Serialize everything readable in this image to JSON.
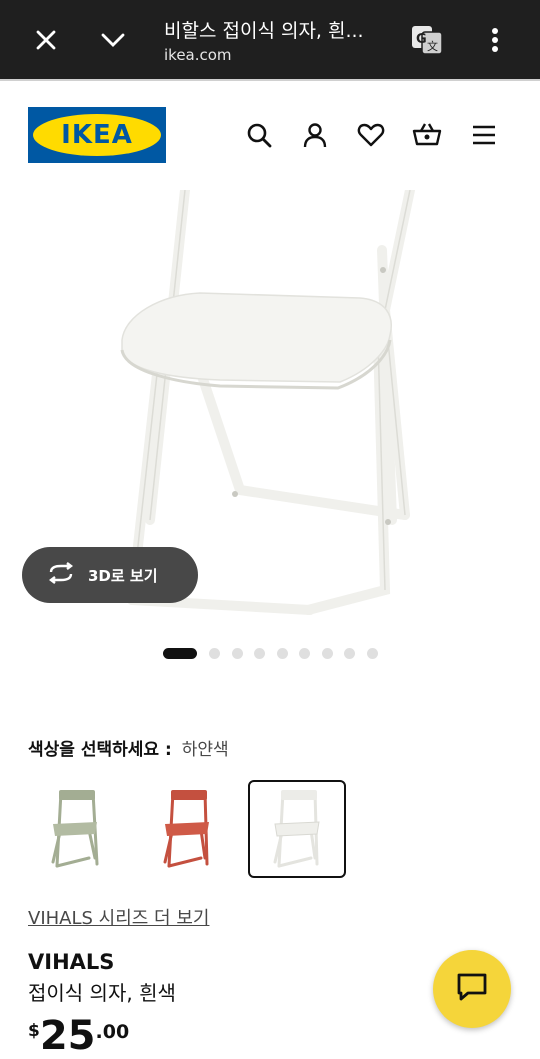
{
  "browser": {
    "title": "비할스 접이식 의자, 흰...",
    "url": "ikea.com",
    "icons": [
      "close-icon",
      "chevron-down-icon",
      "translate-icon",
      "more-vert-icon"
    ]
  },
  "header": {
    "logo_text": "IKEA",
    "icons": [
      "search-icon",
      "account-icon",
      "heart-icon",
      "cart-icon",
      "menu-icon"
    ],
    "brand_blue": "#0058a3",
    "brand_yellow": "#ffdb00"
  },
  "gallery": {
    "view_3d_label": "3D로 보기",
    "image_count": 10,
    "active_index": 0
  },
  "color_select": {
    "label": "색상을 선택하세요 :",
    "selected": "하얀색",
    "swatches": [
      {
        "color": "#a3ad93"
      },
      {
        "color": "#c4503f"
      },
      {
        "color": "#f2f2ee"
      }
    ]
  },
  "product": {
    "series_link": "VIHALS 시리즈 더 보기",
    "name": "VIHALS",
    "description": "접이식 의자, 흰색",
    "price_currency": "$",
    "price_integer": "25",
    "price_decimal": ".00"
  },
  "chat": {
    "icon": "chat-icon",
    "color": "#f5d53a"
  }
}
